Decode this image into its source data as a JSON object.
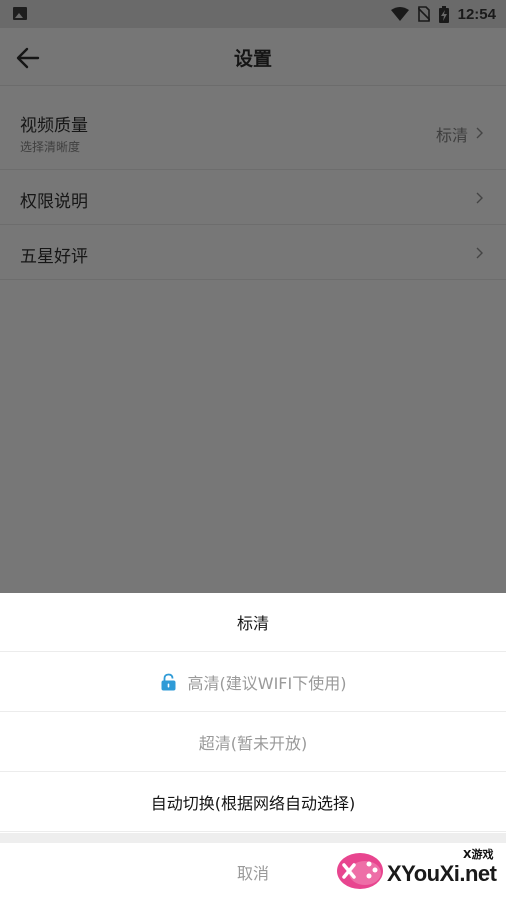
{
  "status_bar": {
    "time": "12:54",
    "icons": [
      "image-icon",
      "wifi-icon",
      "no-sim-icon",
      "battery-charging-icon"
    ]
  },
  "header": {
    "back_icon": "arrow-left-icon",
    "title": "设置"
  },
  "settings": {
    "items": [
      {
        "title": "视频质量",
        "subtitle": "选择清晰度",
        "value": "标清"
      },
      {
        "title": "权限说明"
      },
      {
        "title": "五星好评"
      }
    ]
  },
  "sheet": {
    "options": [
      {
        "label": "标清",
        "state": "selected"
      },
      {
        "label": "高清(建议WIFI下使用)",
        "state": "locked",
        "icon": "lock-icon",
        "icon_color": "#2f9bd7"
      },
      {
        "label": "超清(暂未开放)",
        "state": "disabled"
      },
      {
        "label": "自动切换(根据网络自动选择)",
        "state": "enabled"
      }
    ],
    "cancel_label": "取消"
  },
  "watermark": {
    "small_text": "X游戏",
    "main_text": "XYouXi.net"
  },
  "colors": {
    "overlay_dim": "#777777",
    "lock_blue": "#2f9bd7",
    "disabled_text": "#9a9a9a"
  }
}
